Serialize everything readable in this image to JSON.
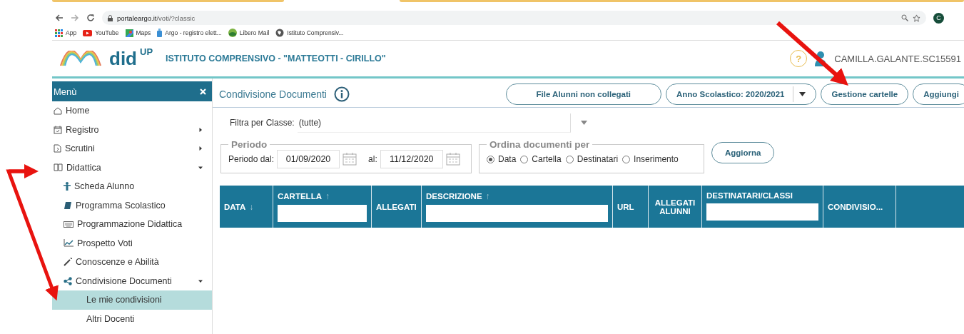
{
  "browser": {
    "url_host": "portaleargo.it",
    "url_path": "/voti/?classic",
    "profile": "C",
    "bookmarks": [
      {
        "label": "App"
      },
      {
        "label": "YouTube"
      },
      {
        "label": "Maps"
      },
      {
        "label": "Argo - registro elett..."
      },
      {
        "label": "Libero Mail"
      },
      {
        "label": "Istituto Comprensiv..."
      }
    ]
  },
  "header": {
    "logo": "did",
    "logo_sup": "UP",
    "school": "ISTITUTO COMPRENSIVO - \"MATTEOTTI - CIRILLO\"",
    "help": "?",
    "user": "CAMILLA.GALANTE.SC15591"
  },
  "sidebar": {
    "title": "Menù",
    "items": [
      {
        "label": "Home",
        "selected": false
      },
      {
        "label": "Registro",
        "selected": false,
        "expanded": false
      },
      {
        "label": "Scrutini",
        "selected": false,
        "expanded": false
      },
      {
        "label": "Didattica",
        "selected": false,
        "expanded": true,
        "children": [
          {
            "label": "Scheda Alunno",
            "selected": false
          },
          {
            "label": "Programma Scolastico",
            "selected": false
          },
          {
            "label": "Programmazione Didattica",
            "selected": false
          },
          {
            "label": "Prospetto Voti",
            "selected": false
          },
          {
            "label": "Conoscenze e Abilità",
            "selected": false
          },
          {
            "label": "Condivisione Documenti",
            "selected": false,
            "expanded": true,
            "children": [
              {
                "label": "Le mie condivisioni",
                "selected": true
              },
              {
                "label": "Altri Docenti",
                "selected": false
              }
            ]
          }
        ]
      }
    ]
  },
  "main": {
    "title": "Condivisione Documenti",
    "buttons": [
      {
        "label": "File Alunni non collegati",
        "kind": "plain"
      },
      {
        "label": "Anno Scolastico: 2020/2021",
        "kind": "dropdown"
      },
      {
        "label": "Gestione cartelle",
        "kind": "plain"
      },
      {
        "label": "Aggiungi",
        "kind": "plain"
      }
    ],
    "filter": {
      "label": "Filtra per Classe:",
      "value": "(tutte)"
    },
    "period": {
      "legend": "Periodo",
      "from_label": "Periodo dal:",
      "from": "01/09/2020",
      "to_label": "al:",
      "to": "11/12/2020"
    },
    "order": {
      "legend": "Ordina documenti per",
      "options": [
        {
          "label": "Data",
          "selected": true
        },
        {
          "label": "Cartella",
          "selected": false
        },
        {
          "label": "Destinatari",
          "selected": false
        },
        {
          "label": "Inserimento",
          "selected": false
        }
      ]
    },
    "refresh": "Aggiorna",
    "table": {
      "columns": [
        {
          "label": "DATA",
          "sort": "↓",
          "filter": false
        },
        {
          "label": "CARTELLA",
          "sort": "↑",
          "filter": true
        },
        {
          "label": "ALLEGATI",
          "filter": false
        },
        {
          "label": "DESCRIZIONE",
          "sort": "↑",
          "filter": true
        },
        {
          "label": "URL",
          "filter": false
        },
        {
          "label": "ALLEGATI ALUNNI",
          "filter": false
        },
        {
          "label": "DESTINATARI/CLASSI",
          "filter": true
        },
        {
          "label": "CONDIVISIO...",
          "filter": false
        }
      ]
    }
  }
}
